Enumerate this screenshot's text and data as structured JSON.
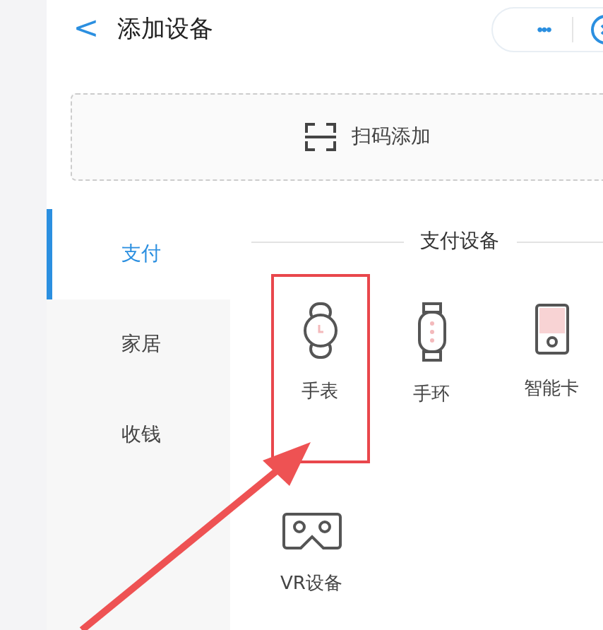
{
  "header": {
    "back": "<",
    "title": "添加设备",
    "menu": "•••"
  },
  "scan": {
    "label": "扫码添加"
  },
  "sidebar": {
    "items": [
      {
        "label": "支付",
        "selected": true
      },
      {
        "label": "家居",
        "selected": false
      },
      {
        "label": "收钱",
        "selected": false
      }
    ]
  },
  "section": {
    "title": "支付设备",
    "devices": [
      {
        "kind": "watch",
        "label": "手表",
        "highlighted": true
      },
      {
        "kind": "band",
        "label": "手环",
        "highlighted": false
      },
      {
        "kind": "card",
        "label": "智能卡",
        "highlighted": false
      },
      {
        "kind": "vr",
        "label": "VR设备",
        "highlighted": false
      }
    ]
  },
  "annotation": {
    "kind": "arrow"
  }
}
